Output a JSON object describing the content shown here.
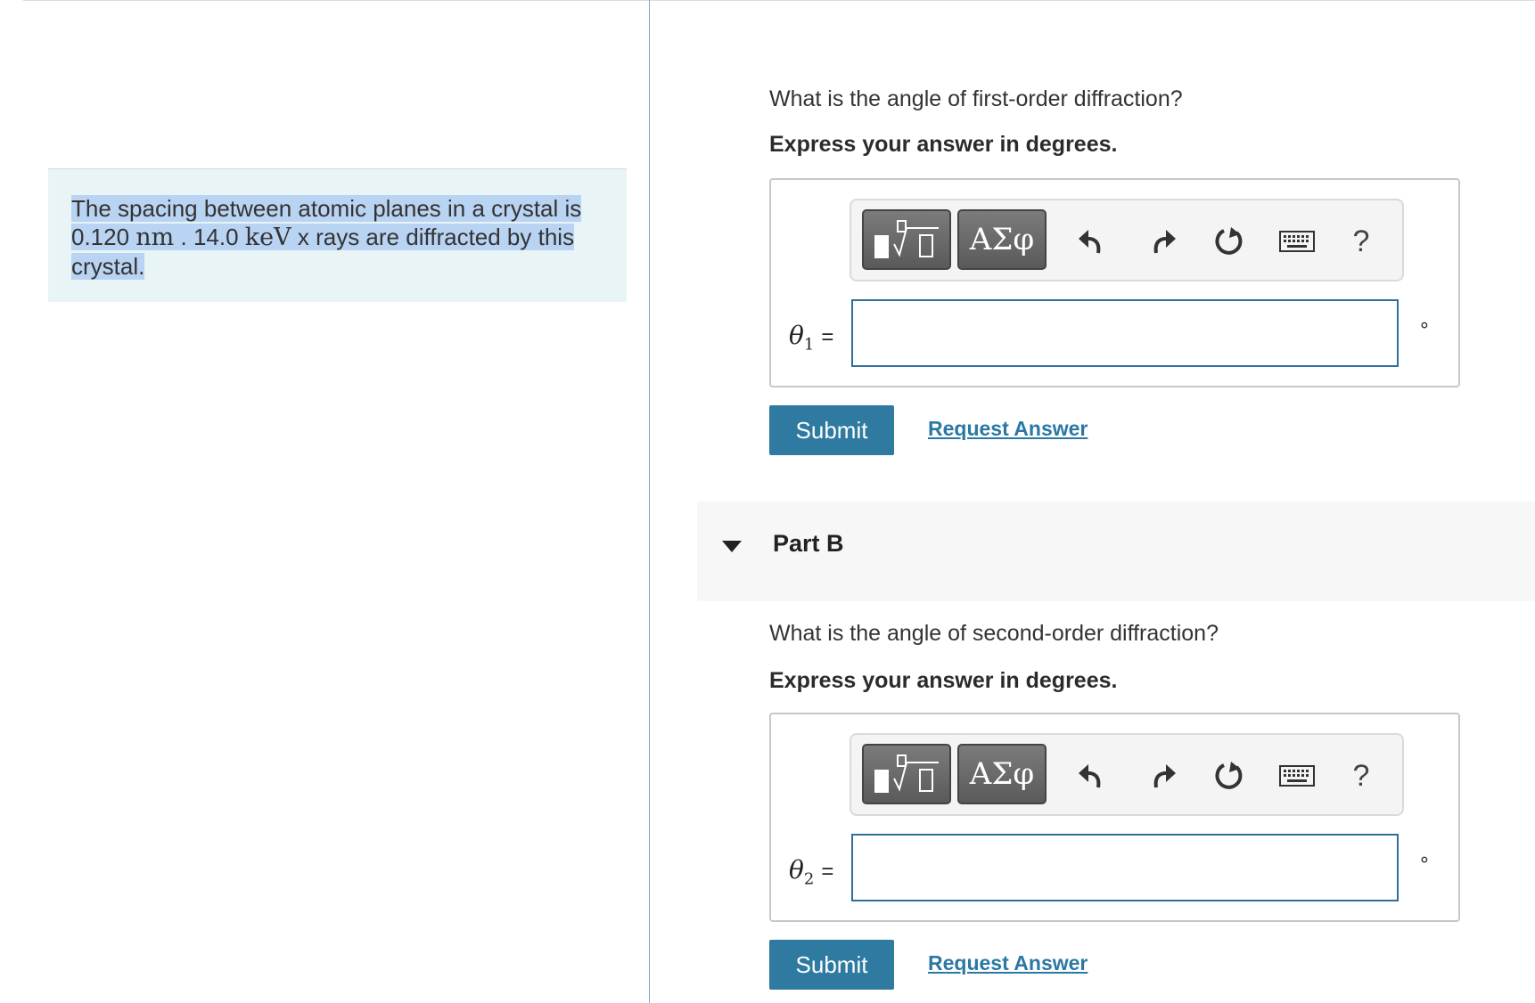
{
  "problem": {
    "text_before_nm": "The spacing between atomic planes in a crystal is 0.120 ",
    "unit_nm": "nm",
    "text_between": " . 14.0 ",
    "unit_kev": "keV",
    "text_after": " x rays are diffracted by this crystal."
  },
  "part_a": {
    "question": "What is the angle of first-order diffraction?",
    "instruction": "Express your answer in degrees.",
    "variable": "θ",
    "subscript": "1",
    "equals": "=",
    "input_value": "",
    "unit_symbol": "∘",
    "submit_label": "Submit",
    "request_label": "Request Answer"
  },
  "part_b": {
    "header": "Part B",
    "question": "What is the angle of second-order diffraction?",
    "instruction": "Express your answer in degrees.",
    "variable": "θ",
    "subscript": "2",
    "equals": "=",
    "input_value": "",
    "unit_symbol": "∘",
    "submit_label": "Submit",
    "request_label": "Request Answer"
  },
  "toolbar": {
    "greek_label": "ΑΣφ",
    "help_label": "?",
    "icons": [
      "templates-icon",
      "greek-symbols",
      "undo-icon",
      "redo-icon",
      "reset-icon",
      "keyboard-icon",
      "help-icon"
    ]
  },
  "colors": {
    "accent": "#2e7aa0",
    "link": "#2a78a3",
    "problem_bg": "#e9f4f7",
    "selection": "#b9d3f3",
    "input_border": "#2e6e98"
  }
}
